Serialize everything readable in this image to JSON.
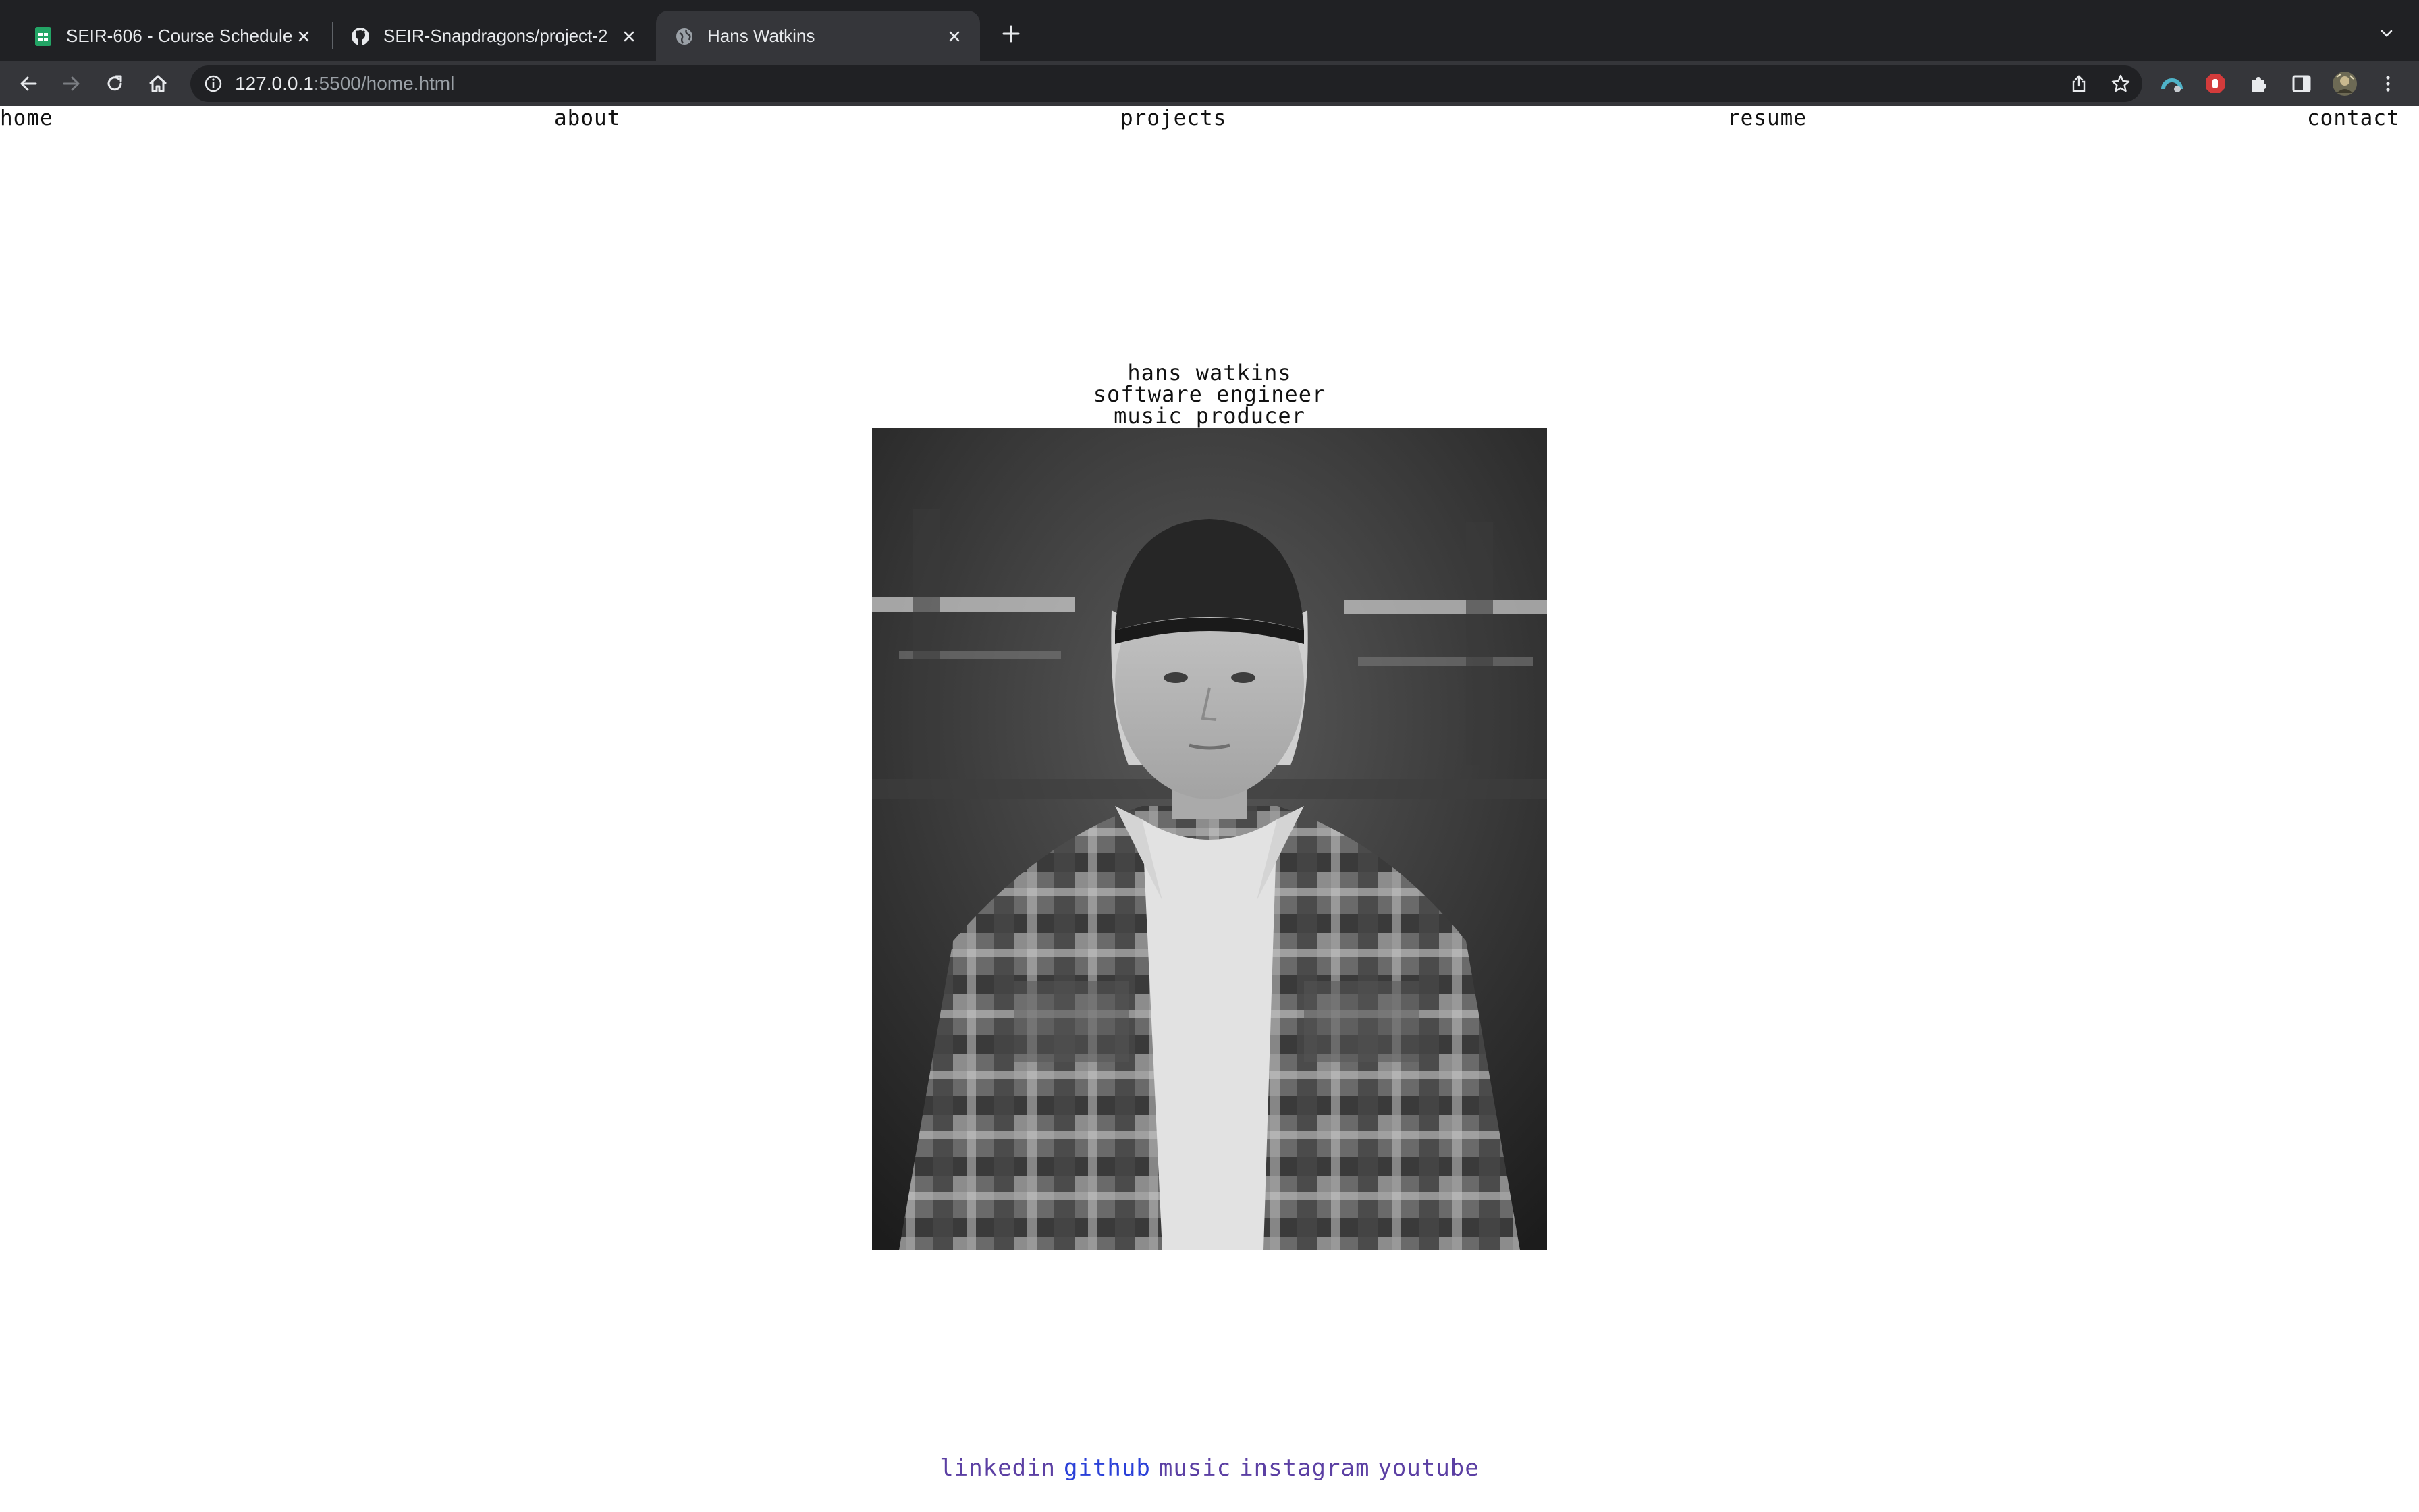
{
  "browser": {
    "tabs": [
      {
        "title": "SEIR-606 - Course Schedule -",
        "icon": "sheets-icon",
        "active": false
      },
      {
        "title": "SEIR-Snapdragons/project-2",
        "icon": "github-icon",
        "active": false
      },
      {
        "title": "Hans Watkins",
        "icon": "globe-icon",
        "active": true
      }
    ],
    "url_host": "127.0.0.1",
    "url_rest": ":5500/home.html"
  },
  "nav": {
    "home": "home",
    "about": "about",
    "projects": "projects",
    "resume": "resume",
    "contact": "contact"
  },
  "intro": {
    "name": "hans watkins",
    "line1": "software engineer",
    "line2": "music producer"
  },
  "footer": {
    "linkedin": "linkedin",
    "github": "github",
    "music": "music",
    "instagram": "instagram",
    "youtube": "youtube"
  },
  "colors": {
    "tabbar_bg": "#202124",
    "toolbar_bg": "#35363a",
    "link_visited": "#5b3fa3",
    "link_unvisited": "#2a40d8"
  }
}
